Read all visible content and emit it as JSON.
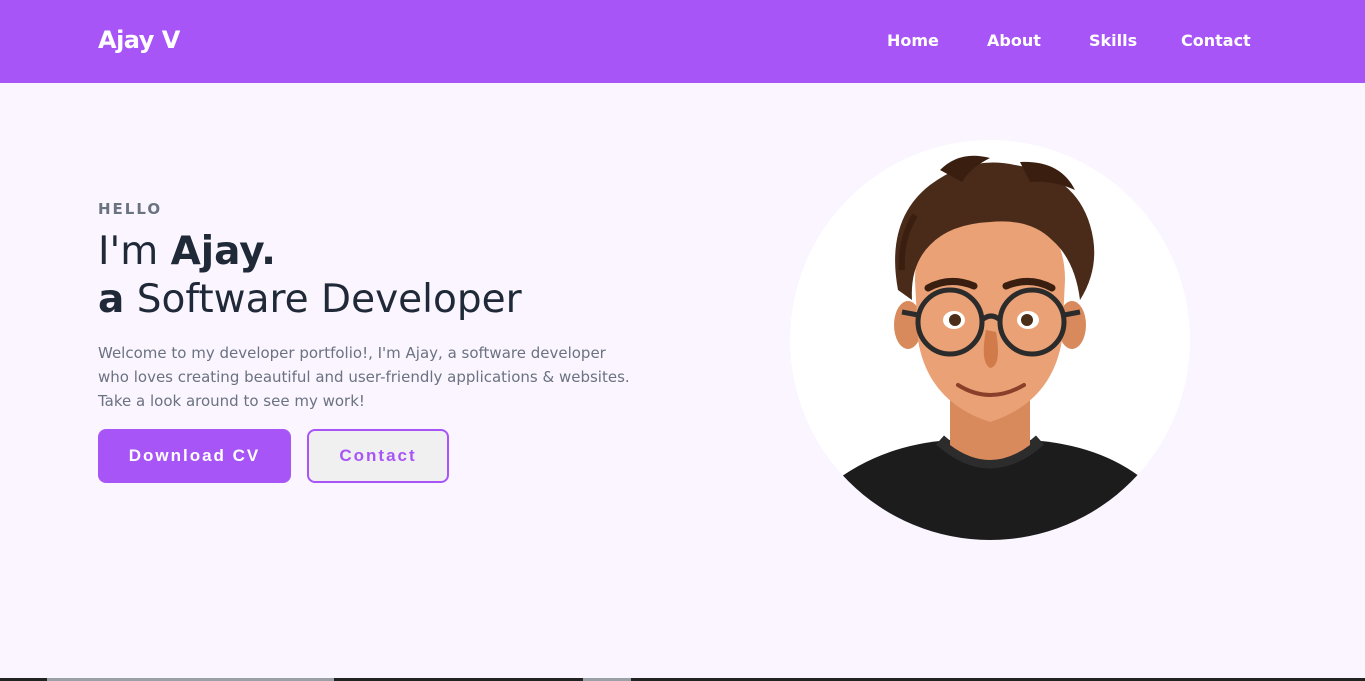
{
  "header": {
    "brand": "Ajay V",
    "nav": [
      {
        "label": "Home"
      },
      {
        "label": "About"
      },
      {
        "label": "Skills"
      },
      {
        "label": "Contact"
      }
    ]
  },
  "hero": {
    "eyebrow": "HELLO",
    "line1_prefix": "I'm ",
    "line1_name": "Ajay.",
    "line2_article": "a",
    "line2_role": " Software Developer",
    "intro": "Welcome to my developer portfolio!, I'm Ajay, a software developer who loves creating beautiful and user-friendly applications & websites. Take a look around to see my work!",
    "primary_button": "Download CV",
    "secondary_button": "Contact"
  },
  "colors": {
    "accent": "#a855f7",
    "background": "#faf5ff",
    "text_dark": "#1f2937",
    "text_muted": "#6b7280"
  },
  "icons": {
    "avatar": "cartoon-developer-portrait"
  }
}
